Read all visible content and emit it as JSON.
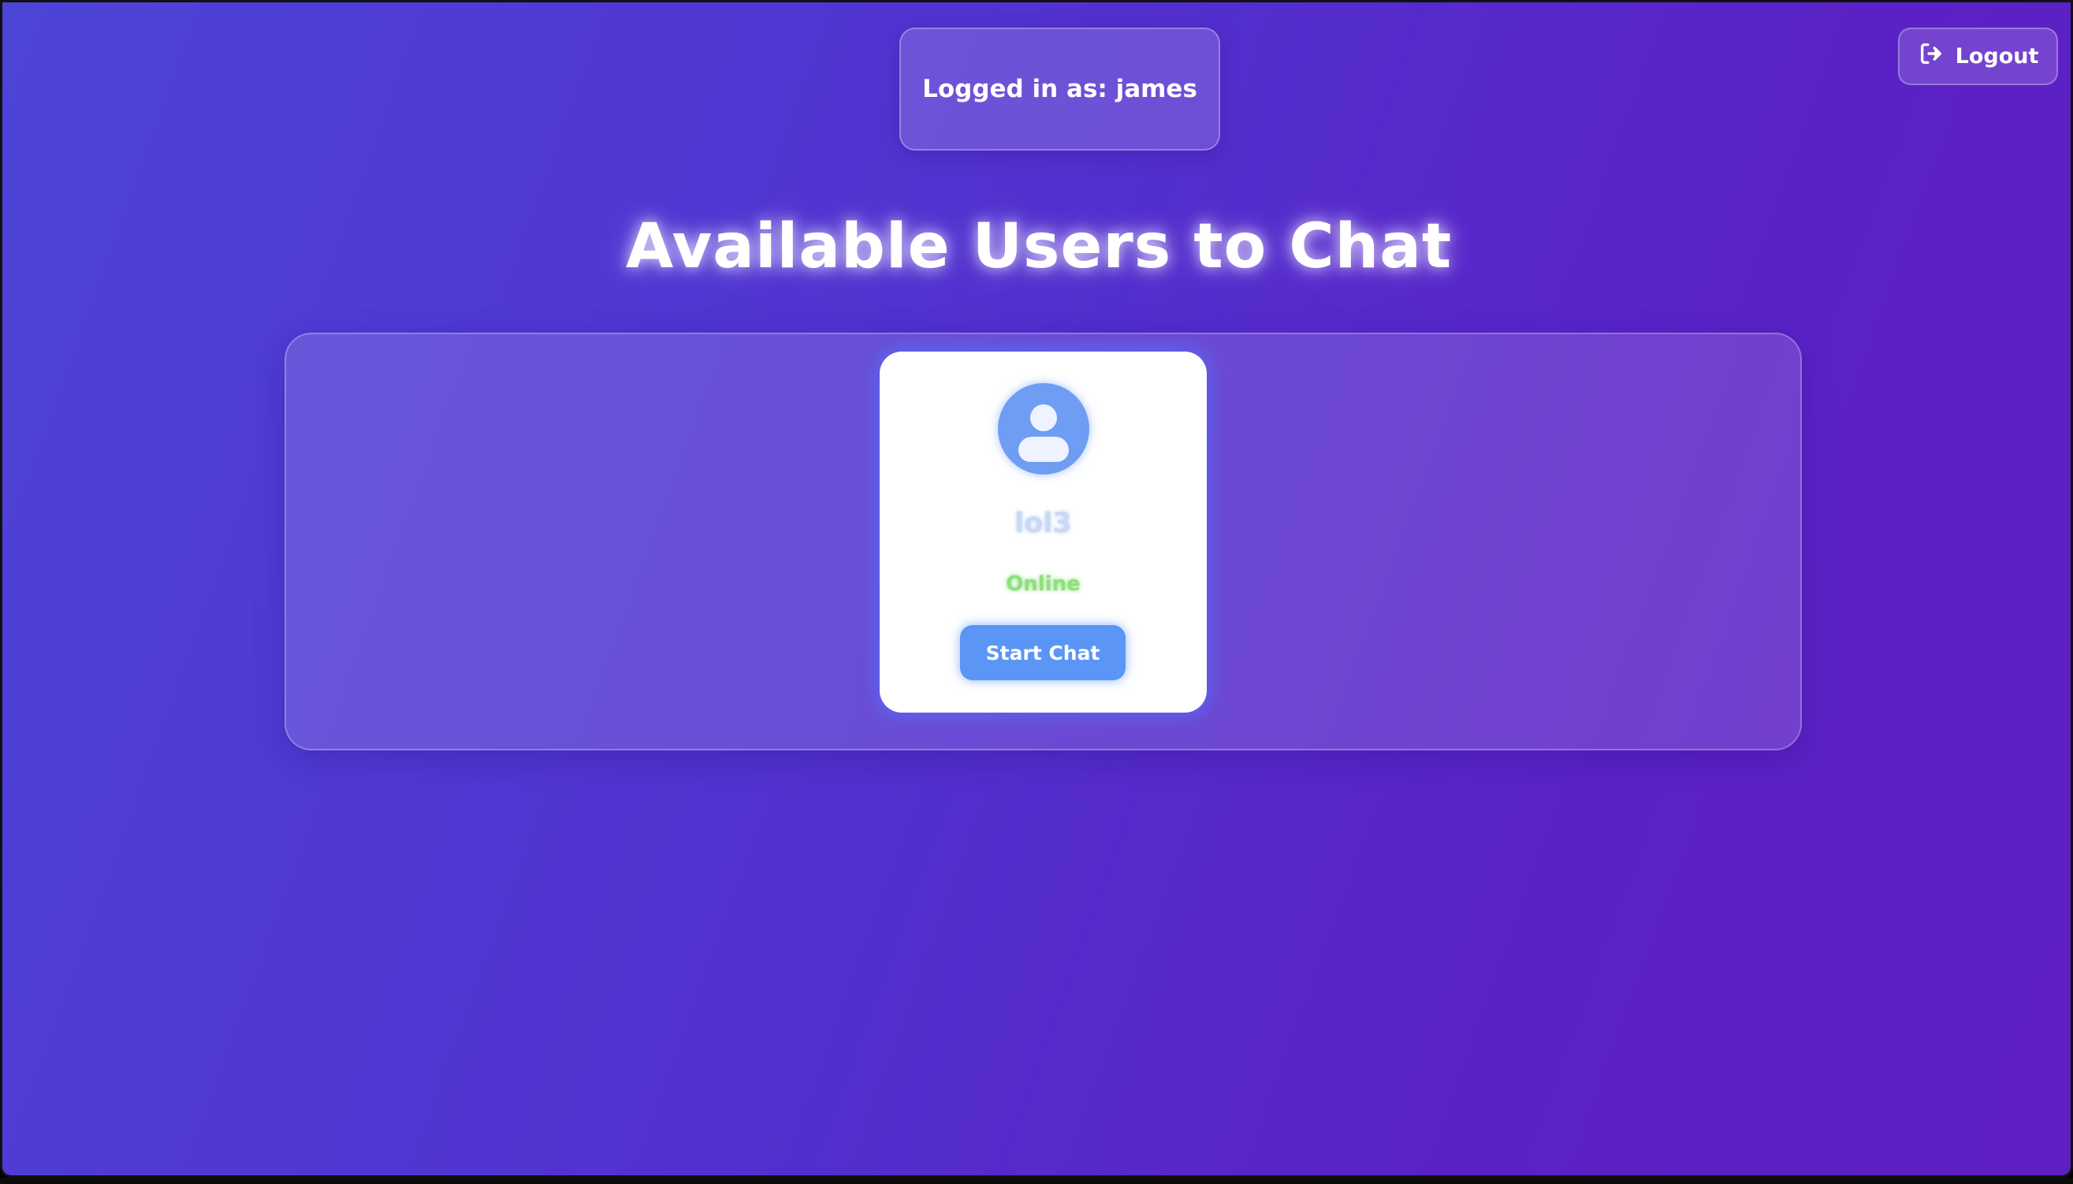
{
  "header": {
    "logged_in_text": "Logged in as: james",
    "logout_label": "Logout",
    "logout_icon": "logout-icon"
  },
  "main": {
    "title": "Available Users to Chat"
  },
  "users": [
    {
      "username": "lol3",
      "status": "Online",
      "avatar_icon": "user-avatar-icon",
      "action_label": "Start Chat"
    }
  ],
  "colors": {
    "accent": "#5b95f5",
    "online": "#8fe07e",
    "background_start": "#4d44d8",
    "background_end": "#5e1ec3"
  }
}
